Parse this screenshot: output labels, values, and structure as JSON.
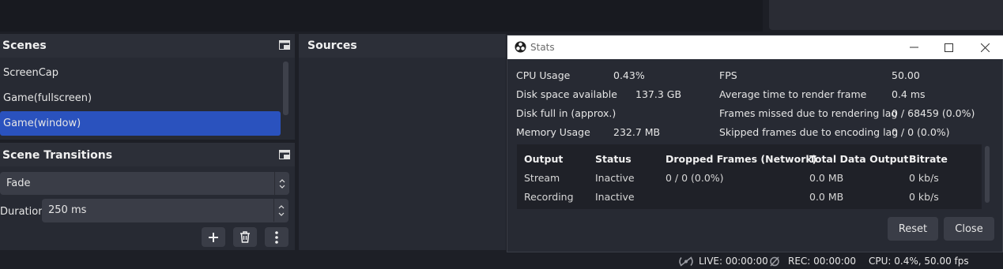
{
  "scenes": {
    "title": "Scenes",
    "items": [
      {
        "label": "ScreenCap"
      },
      {
        "label": "Game(fullscreen)"
      },
      {
        "label": "Game(window)"
      }
    ]
  },
  "transitions": {
    "title": "Scene Transitions",
    "type": "Fade",
    "duration_label": "Duration",
    "duration_value": "250 ms"
  },
  "sources": {
    "title": "Sources"
  },
  "stats_window": {
    "title": "Stats",
    "left_stats": [
      {
        "label": "CPU Usage",
        "value": "0.43%"
      },
      {
        "label": "Disk space available",
        "value": "137.3 GB"
      },
      {
        "label": "Disk full in (approx.)",
        "value": ""
      },
      {
        "label": "Memory Usage",
        "value": "232.7 MB"
      }
    ],
    "right_stats": [
      {
        "label": "FPS",
        "value": "50.00"
      },
      {
        "label": "Average time to render frame",
        "value": "0.4 ms"
      },
      {
        "label": "Frames missed due to rendering lag",
        "value": "0 / 68459 (0.0%)"
      },
      {
        "label": "Skipped frames due to encoding lag",
        "value": "0 / 0 (0.0%)"
      }
    ],
    "table": {
      "headers": [
        "Output",
        "Status",
        "Dropped Frames (Network)",
        "Total Data Output",
        "Bitrate"
      ],
      "rows": [
        [
          "Stream",
          "Inactive",
          "0 / 0 (0.0%)",
          "0.0 MB",
          "0 kb/s"
        ],
        [
          "Recording",
          "Inactive",
          "",
          "0.0 MB",
          "0 kb/s"
        ]
      ]
    },
    "reset_label": "Reset",
    "close_label": "Close"
  },
  "status_bar": {
    "live": "LIVE: 00:00:00",
    "rec": "REC: 00:00:00",
    "cpu": "CPU: 0.4%, 50.00 fps"
  },
  "colors": {
    "accent": "#2a52be",
    "background": "#1d1f26",
    "panel": "#272a33"
  }
}
